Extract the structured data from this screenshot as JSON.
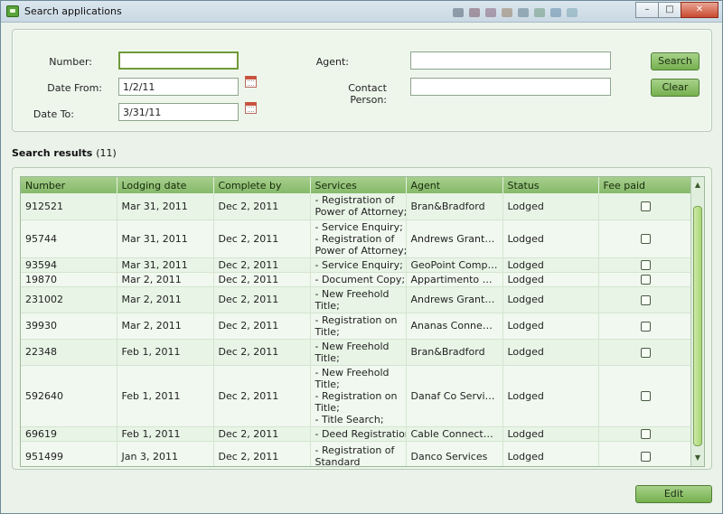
{
  "window": {
    "title": "Search applications",
    "minimize": "–",
    "maximize": "□",
    "close": "✕"
  },
  "filters": {
    "number_label": "Number:",
    "number_value": "",
    "date_from_label": "Date From:",
    "date_from_value": "1/2/11",
    "date_to_label": "Date To:",
    "date_to_value": "3/31/11",
    "agent_label": "Agent:",
    "agent_value": "",
    "contact_label": "Contact Person:",
    "contact_value": "",
    "search_label": "Search",
    "clear_label": "Clear"
  },
  "results": {
    "title": "Search results",
    "count": "(11)",
    "columns": [
      "Number",
      "Lodging date",
      "Complete by",
      "Services",
      "Agent",
      "Status",
      "Fee paid"
    ],
    "rows": [
      {
        "number": "912521",
        "lodging": "Mar 31, 2011",
        "complete": "Dec 2, 2011",
        "services": [
          "- Registration of",
          "Power of Attorney;"
        ],
        "agent": "Bran&Bradford",
        "status": "Lodged",
        "fee_paid": false
      },
      {
        "number": "95744",
        "lodging": "Mar 31, 2011",
        "complete": "Dec 2, 2011",
        "services": [
          "- Service Enquiry;",
          "- Registration of",
          "Power of Attorney;"
        ],
        "agent": "Andrews Grant Co...",
        "status": "Lodged",
        "fee_paid": false
      },
      {
        "number": "93594",
        "lodging": "Mar 31, 2011",
        "complete": "Dec 2, 2011",
        "services": [
          "- Service Enquiry;"
        ],
        "agent": "GeoPoint Compan...",
        "status": "Lodged",
        "fee_paid": false
      },
      {
        "number": "19870",
        "lodging": "Mar 2, 2011",
        "complete": "Dec 2, 2011",
        "services": [
          "- Document Copy;"
        ],
        "agent": "Appartimento Dan...",
        "status": "Lodged",
        "fee_paid": false
      },
      {
        "number": "231002",
        "lodging": "Mar 2, 2011",
        "complete": "Dec 2, 2011",
        "services": [
          "- New Freehold",
          "Title;"
        ],
        "agent": "Andrews Grant Co...",
        "status": "Lodged",
        "fee_paid": false
      },
      {
        "number": "39930",
        "lodging": "Mar 2, 2011",
        "complete": "Dec 2, 2011",
        "services": [
          "- Registration on",
          "Title;"
        ],
        "agent": "Ananas Connection",
        "status": "Lodged",
        "fee_paid": false
      },
      {
        "number": "22348",
        "lodging": "Feb 1, 2011",
        "complete": "Dec 2, 2011",
        "services": [
          "- New Freehold",
          "Title;"
        ],
        "agent": "Bran&Bradford",
        "status": "Lodged",
        "fee_paid": false
      },
      {
        "number": "592640",
        "lodging": "Feb 1, 2011",
        "complete": "Dec 2, 2011",
        "services": [
          "- New Freehold",
          "Title;",
          "- Registration on",
          "Title;",
          "- Title Search;"
        ],
        "agent": "Danaf Co Services",
        "status": "Lodged",
        "fee_paid": false
      },
      {
        "number": "69619",
        "lodging": "Feb 1, 2011",
        "complete": "Dec 2, 2011",
        "services": [
          "- Deed Registration;"
        ],
        "agent": "Cable Connectors",
        "status": "Lodged",
        "fee_paid": false
      },
      {
        "number": "951499",
        "lodging": "Jan 3, 2011",
        "complete": "Dec 2, 2011",
        "services": [
          "- Registration of",
          "Standard"
        ],
        "agent": "Danco Services",
        "status": "Lodged",
        "fee_paid": false
      }
    ]
  },
  "footer": {
    "edit_label": "Edit"
  },
  "icons": {
    "app": "app-icon",
    "calendar": "calendar-icon",
    "scroll_up": "scroll-up-arrow-icon",
    "scroll_down": "scroll-down-arrow-icon"
  },
  "colors": {
    "accent_green": "#86b96a",
    "panel_bg": "#eef6ec",
    "close_red": "#c94a2f"
  }
}
